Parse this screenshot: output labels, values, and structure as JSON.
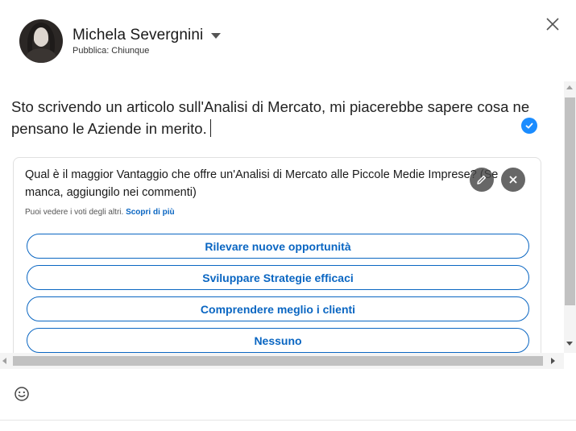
{
  "author": {
    "name": "Michela Severgnini",
    "visibility": "Pubblica: Chiunque"
  },
  "post": {
    "text": "Sto scrivendo un articolo sull'Analisi di Mercato, mi piacerebbe sapere cosa ne pensano le Aziende in merito."
  },
  "poll": {
    "question": "Qual è il maggior Vantaggio che offre un'Analisi di Mercato alle Piccole Medie Imprese? (Se manca, aggiungilo nei commenti)",
    "meta_text": "Puoi vedere i voti degli altri.",
    "meta_link": "Scopri di più",
    "options": [
      "Rilevare nuove opportunità",
      "Sviluppare Strategie efficaci",
      "Comprendere meglio i clienti",
      "Nessuno"
    ]
  },
  "icons": {
    "close": "close-icon",
    "edit": "pencil-icon",
    "remove": "close-icon",
    "emoji": "smiley-icon",
    "check": "check-icon",
    "caret": "caret-down-icon"
  },
  "colors": {
    "accent": "#0a66c2",
    "badge": "#1a8cff"
  }
}
